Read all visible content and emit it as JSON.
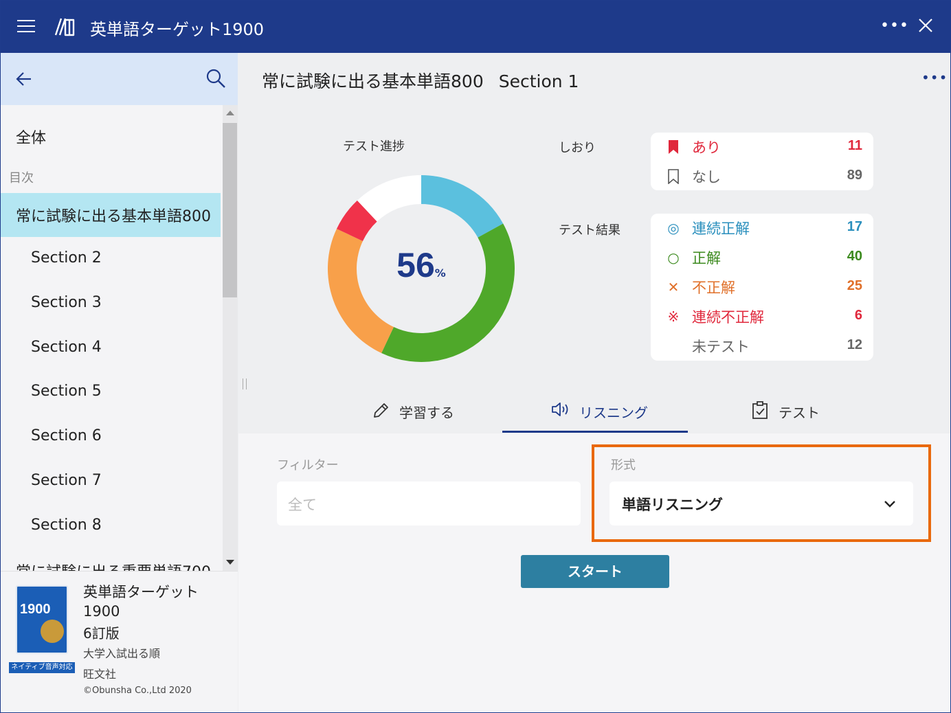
{
  "window": {
    "app_title": "英単語ターゲット1900",
    "menu_icon": "hamburger-icon",
    "more_icon": "more-horizontal-icon",
    "close_icon": "close-icon",
    "more_label": "•••"
  },
  "sidebar": {
    "back_icon": "arrow-left-icon",
    "search_icon": "search-icon",
    "all_label": "全体",
    "toc_label": "目次",
    "active_item": "常に試験に出る基本単語800",
    "items": [
      "Section 2",
      "Section 3",
      "Section 4",
      "Section 5",
      "Section 6",
      "Section 7",
      "Section 8"
    ],
    "next_group": "常に試験に出る重要単語700",
    "book": {
      "name": "英単語ターゲット1900",
      "edition": "6訂版",
      "order": "大学入試出る順",
      "publisher": "旺文社",
      "copyright": "©Obunsha Co.,Ltd 2020",
      "badge": "ネイティブ音声対応",
      "cover_number": "1900"
    }
  },
  "main": {
    "title": "常に試験に出る基本単語800",
    "section": "Section 1",
    "more_label": "•••",
    "progress": {
      "label": "テスト進捗",
      "percent": "56",
      "unit": "%",
      "segments": [
        {
          "name": "連続正解",
          "value": 17,
          "color": "#5bc0de"
        },
        {
          "name": "正解",
          "value": 40,
          "color": "#4fa82a"
        },
        {
          "name": "不正解",
          "value": 25,
          "color": "#f8a04a"
        },
        {
          "name": "連続不正解",
          "value": 6,
          "color": "#f0324a"
        },
        {
          "name": "未テスト",
          "value": 12,
          "color": "#ffffff"
        }
      ]
    },
    "bookmark": {
      "label": "しおり",
      "rows": [
        {
          "label": "あり",
          "count": "11",
          "color": "#e0283c",
          "icon": "bookmark-filled-icon"
        },
        {
          "label": "なし",
          "count": "89",
          "color": "#666666",
          "icon": "bookmark-outline-icon"
        }
      ]
    },
    "results": {
      "label": "テスト結果",
      "rows": [
        {
          "label": "連続正解",
          "count": "17",
          "color": "#2a8fbd",
          "icon": "double-circle-icon",
          "glyph": "◎"
        },
        {
          "label": "正解",
          "count": "40",
          "color": "#3c8a1e",
          "icon": "circle-icon",
          "glyph": "○"
        },
        {
          "label": "不正解",
          "count": "25",
          "color": "#e0702a",
          "icon": "cross-icon",
          "glyph": "✕"
        },
        {
          "label": "連続不正解",
          "count": "6",
          "color": "#e0283c",
          "icon": "kome-mark-icon",
          "glyph": "※"
        },
        {
          "label": "未テスト",
          "count": "12",
          "color": "#666666",
          "icon": "",
          "glyph": ""
        }
      ]
    },
    "tabs": [
      {
        "label": "学習する",
        "icon": "pencil-icon"
      },
      {
        "label": "リスニング",
        "icon": "speaker-icon"
      },
      {
        "label": "テスト",
        "icon": "clipboard-check-icon"
      }
    ],
    "filter": {
      "label": "フィルター",
      "value": "全て"
    },
    "format": {
      "label": "形式",
      "value": "単語リスニング"
    },
    "start_label": "スタート",
    "highlight_color": "#e9690c"
  }
}
